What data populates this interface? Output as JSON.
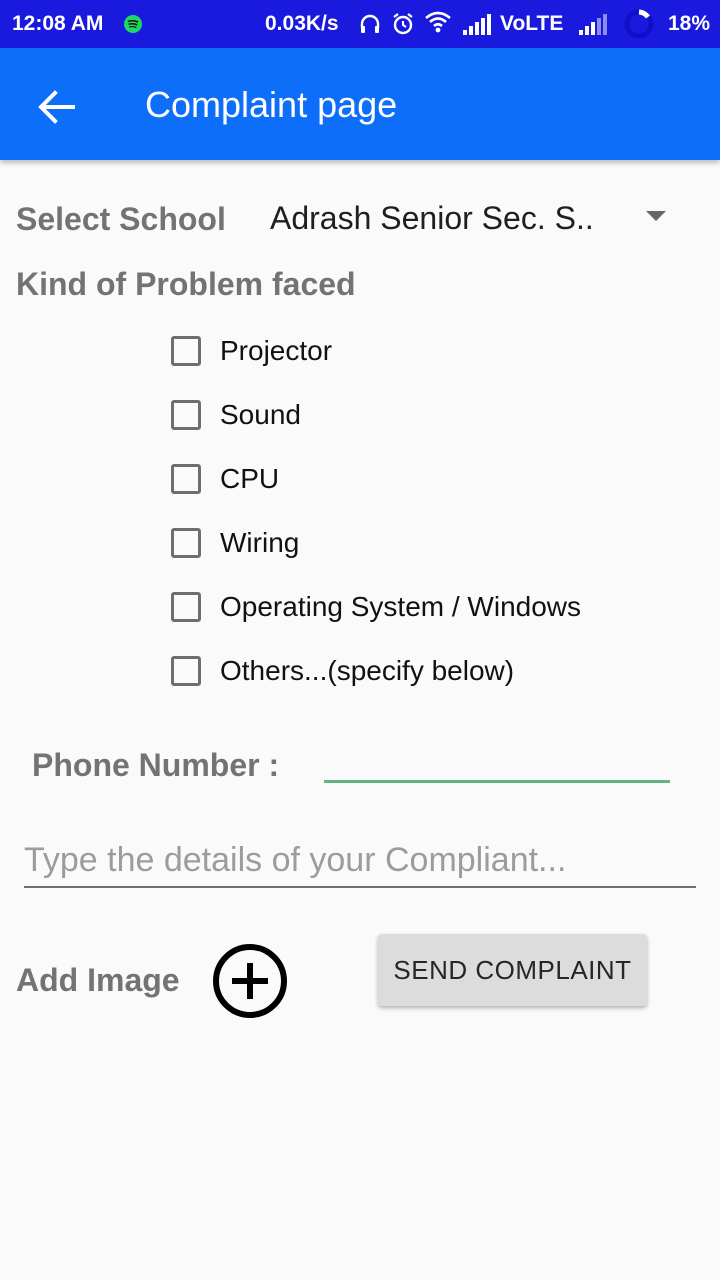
{
  "status_bar": {
    "time": "12:08 AM",
    "net_speed": "0.03K/s",
    "network": "VoLTE",
    "battery": "18%",
    "icons": [
      "spotify-icon",
      "headphones-icon",
      "alarm-icon",
      "wifi-icon",
      "signal-icon",
      "signal-icon",
      "battery-icon"
    ]
  },
  "app_bar": {
    "title": "Complaint page",
    "back_icon": "arrow-back-icon",
    "color": "#0d6efa"
  },
  "form": {
    "school_label": "Select School",
    "school_selected": "Adrash Senior Sec. S..",
    "problem_label": "Kind of Problem faced",
    "problems": [
      {
        "label": "Projector",
        "checked": false
      },
      {
        "label": "Sound",
        "checked": false
      },
      {
        "label": "CPU",
        "checked": false
      },
      {
        "label": "Wiring",
        "checked": false
      },
      {
        "label": "Operating System / Windows",
        "checked": false
      },
      {
        "label": "Others...(specify below)",
        "checked": false
      }
    ],
    "phone_label": "Phone Number :",
    "phone_value": "",
    "details_placeholder": "Type the details of your Compliant...",
    "add_image_label": "Add Image",
    "add_image_icon": "add-circle-icon",
    "send_button": "SEND COMPLAINT",
    "accent_color": "#62b47e"
  }
}
